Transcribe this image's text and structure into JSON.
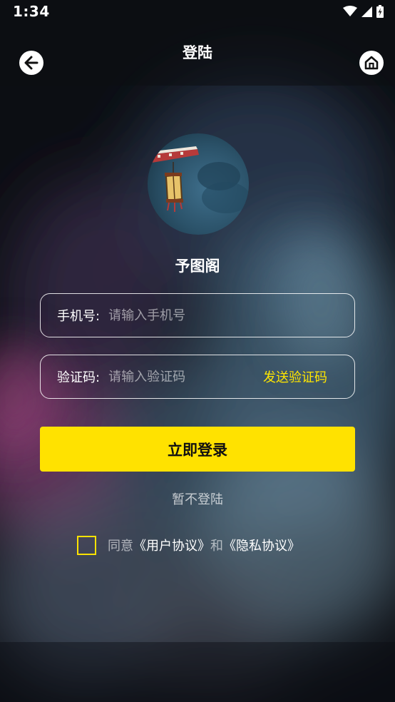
{
  "status_bar": {
    "time": "1:34",
    "icons": [
      "wifi-icon",
      "signal-icon",
      "battery-icon"
    ]
  },
  "header": {
    "title": "登陆",
    "back_icon": "arrow-left-icon",
    "home_icon": "home-icon"
  },
  "app": {
    "name": "予图阁"
  },
  "form": {
    "phone": {
      "label": "手机号:",
      "placeholder": "请输入手机号",
      "value": ""
    },
    "code": {
      "label": "验证码:",
      "placeholder": "请输入验证码",
      "value": "",
      "send_label": "发送验证码"
    }
  },
  "actions": {
    "login_label": "立即登录",
    "skip_label": "暂不登陆"
  },
  "agreement": {
    "checked": false,
    "prefix": "同意",
    "user_agreement": "《用户协议》",
    "and": "和",
    "privacy_policy": "《隐私协议》"
  },
  "colors": {
    "accent": "#ffe200",
    "text": "#ffffff",
    "background": "#0d0f14"
  }
}
